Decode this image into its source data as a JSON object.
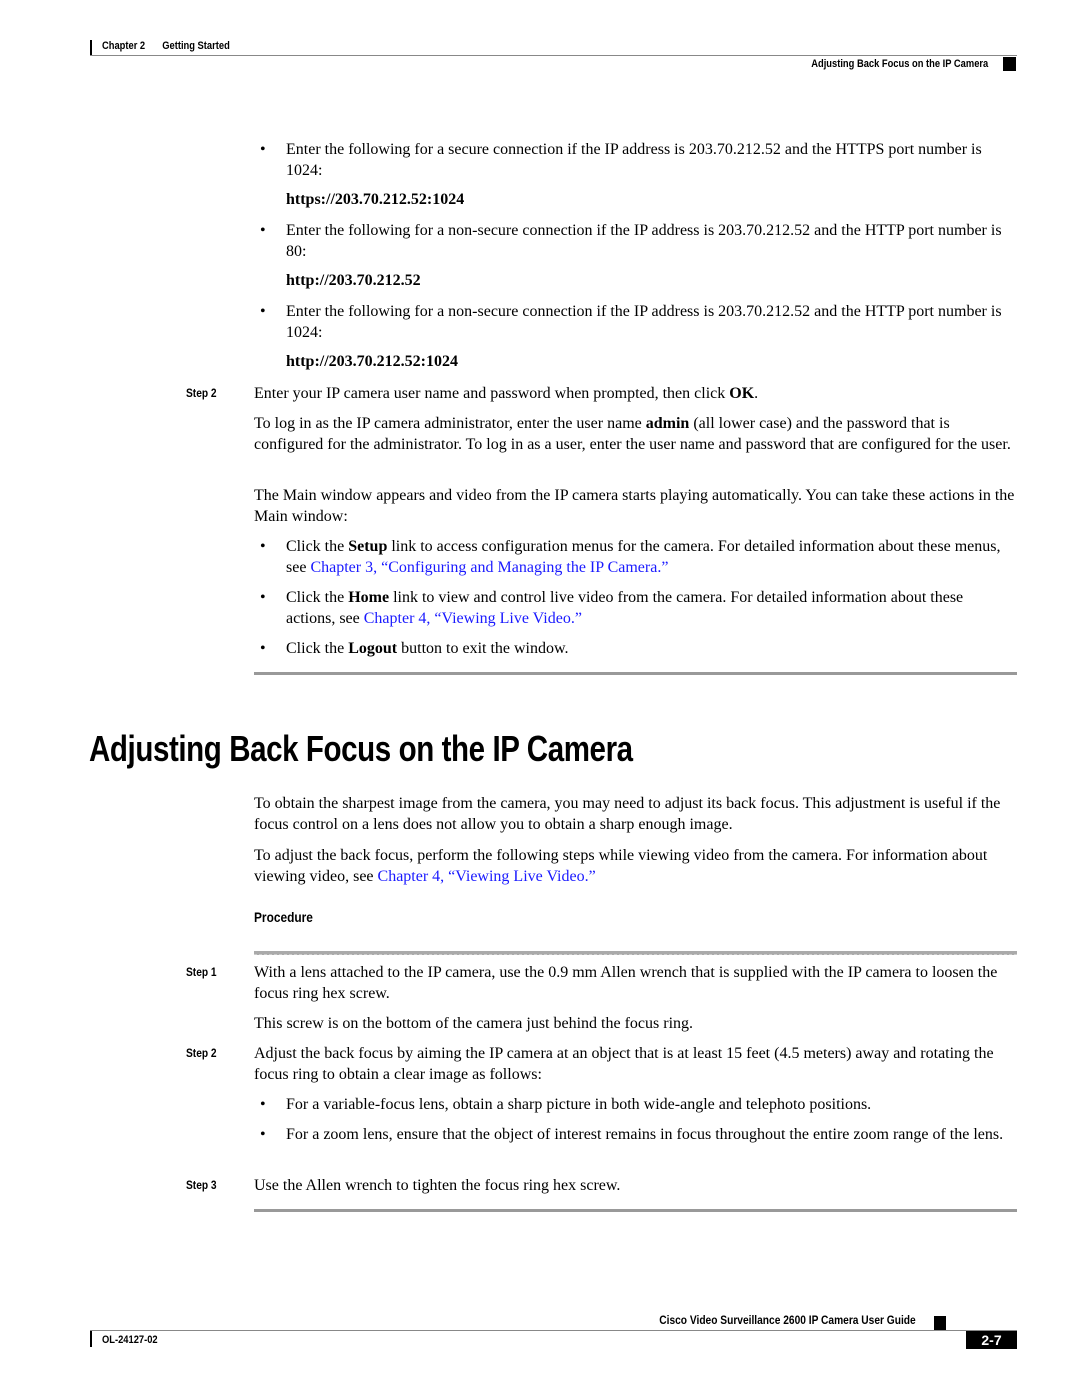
{
  "header": {
    "chapter": "Chapter 2",
    "chapter_title": "Getting Started",
    "section": "Adjusting Back Focus on the IP Camera"
  },
  "top_bullets": [
    {
      "text": "Enter the following for a secure connection if the IP address is 203.70.212.52 and the HTTPS port number is 1024:",
      "code": "https://203.70.212.52:1024"
    },
    {
      "text": "Enter the following for a non-secure connection if the IP address is 203.70.212.52 and the HTTP port number is 80:",
      "code": "http://203.70.212.52"
    },
    {
      "text": "Enter the following for a non-secure connection if the IP address is 203.70.212.52 and the HTTP port number is 1024:",
      "code": "http://203.70.212.52:1024"
    }
  ],
  "step2_login": {
    "label": "Step 2",
    "text_before": "Enter your IP camera user name and password when prompted, then click ",
    "bold": "OK",
    "text_after": ".",
    "para1_before": "To log in as the IP camera administrator, enter the user name ",
    "para1_bold": "admin",
    "para1_after": " (all lower case) and the password that is configured for the administrator. To log in as a user, enter the user name and password that are configured for the user.",
    "para2": "The Main window appears and video from the IP camera starts playing automatically. You can take these actions in the Main window:",
    "actions": [
      {
        "pre": "Click the ",
        "bold": "Setup",
        "post": " link to access configuration menus for the camera. For detailed information about these menus, see ",
        "link": "Chapter 3, “Configuring and Managing the IP Camera.”"
      },
      {
        "pre": "Click the ",
        "bold": "Home",
        "post": " link to view and control live video from the camera. For detailed information about these actions, see ",
        "link": "Chapter 4, “Viewing Live Video.”"
      },
      {
        "pre": "Click the ",
        "bold": "Logout",
        "post": " button to exit the window.",
        "link": ""
      }
    ]
  },
  "section": {
    "title": "Adjusting Back Focus on the IP Camera",
    "intro1": "To obtain the sharpest image from the camera, you may need to adjust its back focus. This adjustment is useful if the focus control on a lens does not allow you to obtain a sharp enough image.",
    "intro2_before": "To adjust the back focus, perform the following steps while viewing video from the camera. For information about viewing video, see ",
    "intro2_link": "Chapter 4, “Viewing Live Video.”",
    "procedure_label": "Procedure",
    "steps": [
      {
        "label": "Step 1",
        "text": "With a lens attached to the IP camera, use the 0.9 mm Allen wrench that is supplied with the IP camera to loosen the focus ring hex screw.",
        "note": "This screw is on the bottom of the camera just behind the focus ring."
      },
      {
        "label": "Step 2",
        "text": "Adjust the back focus by aiming the IP camera at an object that is at least 15 feet (4.5 meters) away and rotating the focus ring to obtain a clear image as follows:",
        "bullets": [
          "For a variable-focus lens, obtain a sharp picture in both wide-angle and telephoto positions.",
          "For a zoom lens, ensure that the object of interest remains in focus throughout the entire zoom range of the lens."
        ]
      },
      {
        "label": "Step 3",
        "text": "Use the Allen wrench to tighten the focus ring hex screw."
      }
    ]
  },
  "footer": {
    "guide_title": "Cisco Video Surveillance 2600 IP Camera User Guide",
    "doc_number": "OL-24127-02",
    "page_number": "2-7"
  },
  "colors": {
    "link": "#1a1aff",
    "rule": "#999999"
  }
}
